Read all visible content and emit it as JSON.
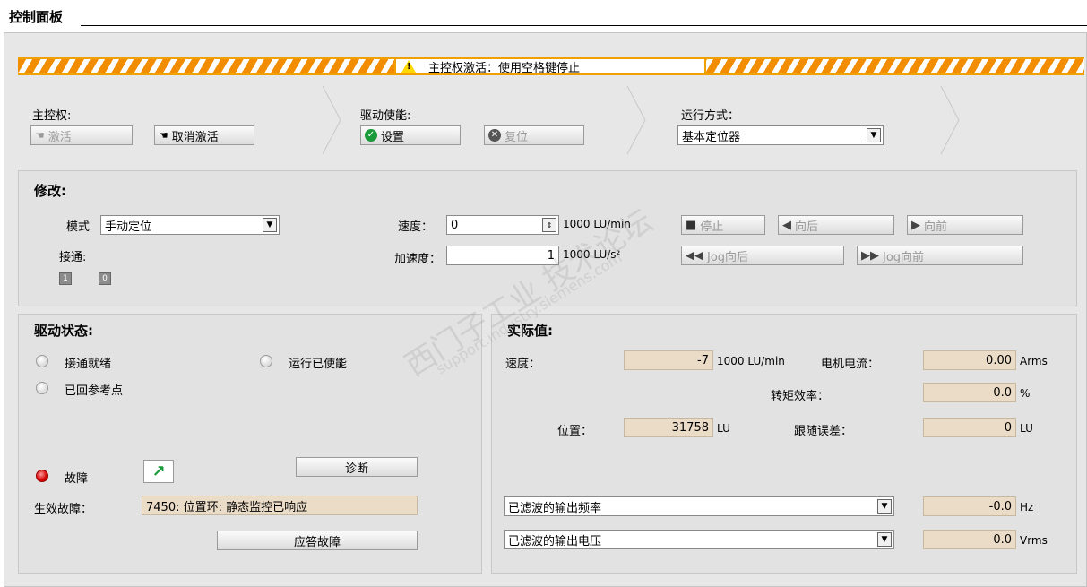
{
  "title": "控制面板",
  "warning": {
    "icon": "warning-triangle-icon",
    "text": "主控权激活：使用空格键停止"
  },
  "master": {
    "label": "主控权:",
    "activate": "激活",
    "deactivate": "取消激活"
  },
  "drive_enable": {
    "label": "驱动使能:",
    "set": "设置",
    "reset": "复位"
  },
  "run_mode": {
    "label": "运行方式：",
    "value": "基本定位器"
  },
  "modify": {
    "title": "修改:",
    "mode_label": "模式",
    "mode_value": "手动定位",
    "connect_label": "接通:",
    "connect_1": "1",
    "connect_0": "0",
    "speed_label": "速度：",
    "speed_value": "0",
    "speed_unit": "1000 LU/min",
    "accel_label": "加速度：",
    "accel_value": "1",
    "accel_unit": "1000 LU/s²",
    "stop": "停止",
    "backward": "向后",
    "forward": "向前",
    "jog_back": "Jog向后",
    "jog_fwd": "Jog向前"
  },
  "drive_status": {
    "title": "驱动状态:",
    "ready": "接通就绪",
    "run_enabled": "运行已使能",
    "referenced": "已回参考点",
    "fault": "故障",
    "diagnose": "诊断",
    "active_fault_label": "生效故障：",
    "active_fault_value": "7450: 位置环: 静态监控已响应",
    "ack_fault": "应答故障"
  },
  "actual": {
    "title": "实际值:",
    "speed_label": "速度：",
    "speed_value": "-7",
    "speed_unit": "1000 LU/min",
    "motor_current_label": "电机电流：",
    "motor_current_value": "0.00",
    "motor_current_unit": "Arms",
    "torque_label": "转矩效率：",
    "torque_value": "0.0",
    "torque_unit": "%",
    "position_label": "位置：",
    "position_value": "31758",
    "position_unit": "LU",
    "following_label": "跟随误差：",
    "following_value": "0",
    "following_unit": "LU",
    "sel1": "已滤波的输出频率",
    "sel1_value": "-0.0",
    "sel1_unit": "Hz",
    "sel2": "已滤波的输出电压",
    "sel2_value": "0.0",
    "sel2_unit": "Vrms"
  },
  "watermark": {
    "main": "西门子工业 技术论坛",
    "sub": "support.industry.siemens.com"
  }
}
